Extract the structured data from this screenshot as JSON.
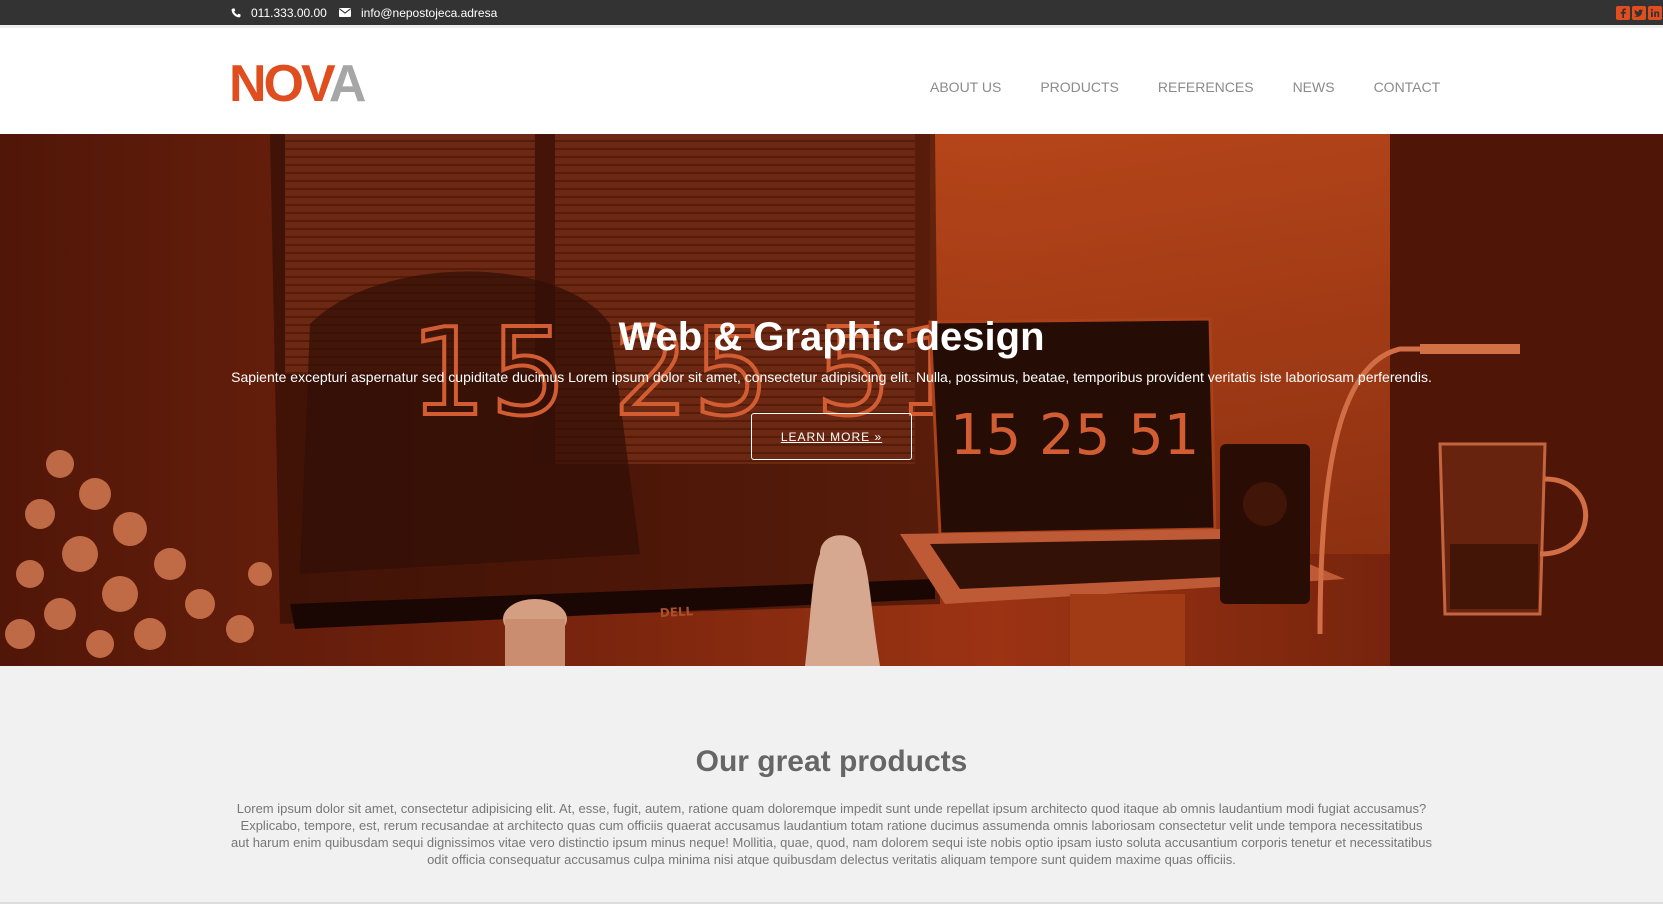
{
  "topbar": {
    "phone": "011.333.00.00",
    "email": "info@nepostojeca.adresa",
    "phone_icon": "phone-icon",
    "email_icon": "envelope-icon",
    "social": [
      "facebook-icon",
      "twitter-icon",
      "linkedin-icon"
    ],
    "social_color": "#e04e1f"
  },
  "header": {
    "logo_part1": "NOV",
    "logo_part2": "A",
    "logo_colors": [
      "#e04e1f",
      "#a6a6a6"
    ],
    "nav": [
      "ABOUT US",
      "PRODUCTS",
      "REFERENCES",
      "NEWS",
      "CONTACT"
    ]
  },
  "hero": {
    "title": "Web & Graphic design",
    "subtitle": "Sapiente excepturi aspernatur sed cupiditate ducimus Lorem ipsum dolor sit amet, consectetur adipisicing elit. Nulla, possimus, beatae, temporibus provident veritatis iste laboriosam perferendis.",
    "button": "LEARN MORE »",
    "background_color": "#c8461c",
    "clock_big": "15 25 51",
    "clock_small": "15 25 51",
    "monitor_brand": "DELL"
  },
  "products": {
    "title": "Our great products",
    "text": "Lorem ipsum dolor sit amet, consectetur adipisicing elit. At, esse, fugit, autem, ratione quam doloremque impedit sunt unde repellat ipsum architecto quod itaque ab omnis laudantium modi fugiat accusamus? Explicabo, tempore, est, rerum recusandae at architecto quas cum officiis quaerat accusamus laudantium totam ratione ducimus assumenda omnis laboriosam consectetur velit unde tempora necessitatibus aut harum enim quibusdam sequi dignissimos vitae vero distinctio ipsum minus neque! Mollitia, quae, quod, nam dolorem sequi iste nobis optio ipsam iusto soluta accusantium corporis tenetur et necessitatibus odit officia consequatur accusamus culpa minima nisi atque quibusdam delectus veritatis aliquam tempore sunt quidem maxime quas officiis."
  }
}
